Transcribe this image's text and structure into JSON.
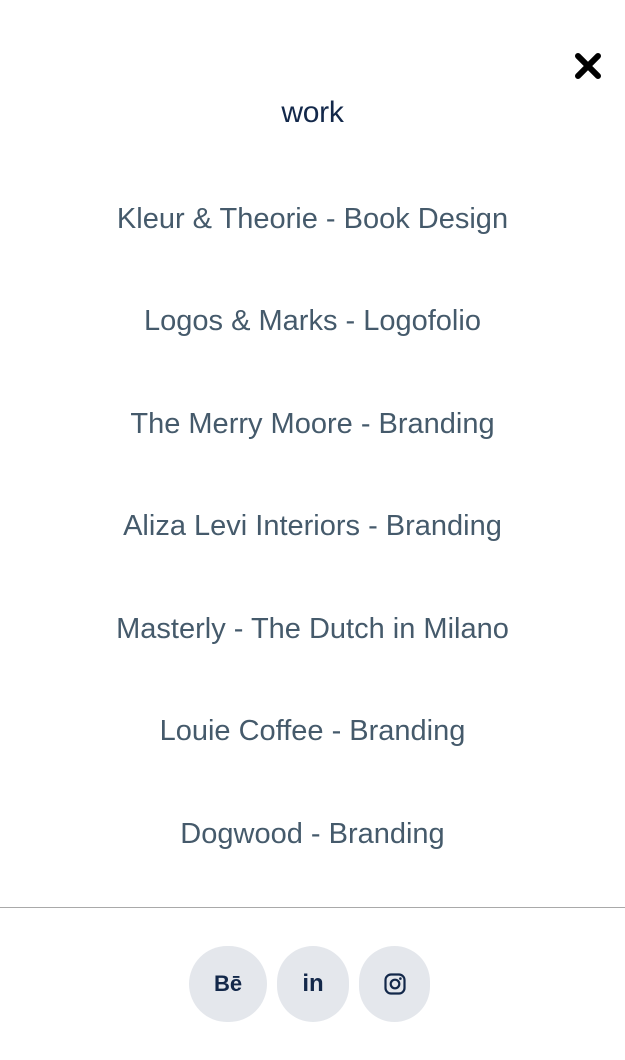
{
  "menu": {
    "title": "work",
    "items": [
      {
        "label": "Kleur & Theorie - Book Design"
      },
      {
        "label": "Logos & Marks - Logofolio"
      },
      {
        "label": "The Merry Moore - Branding"
      },
      {
        "label": "Aliza Levi Interiors - Branding"
      },
      {
        "label": "Masterly - The Dutch in Milano"
      },
      {
        "label": "Louie Coffee - Branding"
      },
      {
        "label": "Dogwood - Branding"
      }
    ]
  },
  "social": {
    "behance_label": "Bē",
    "linkedin_label": "in",
    "instagram_icon": "instagram-icon"
  },
  "icons": {
    "close": "close-icon"
  },
  "colors": {
    "title": "#13284a",
    "link": "#455a6b",
    "social_bg": "#e4e7ec",
    "divider": "#a9a9a9"
  }
}
